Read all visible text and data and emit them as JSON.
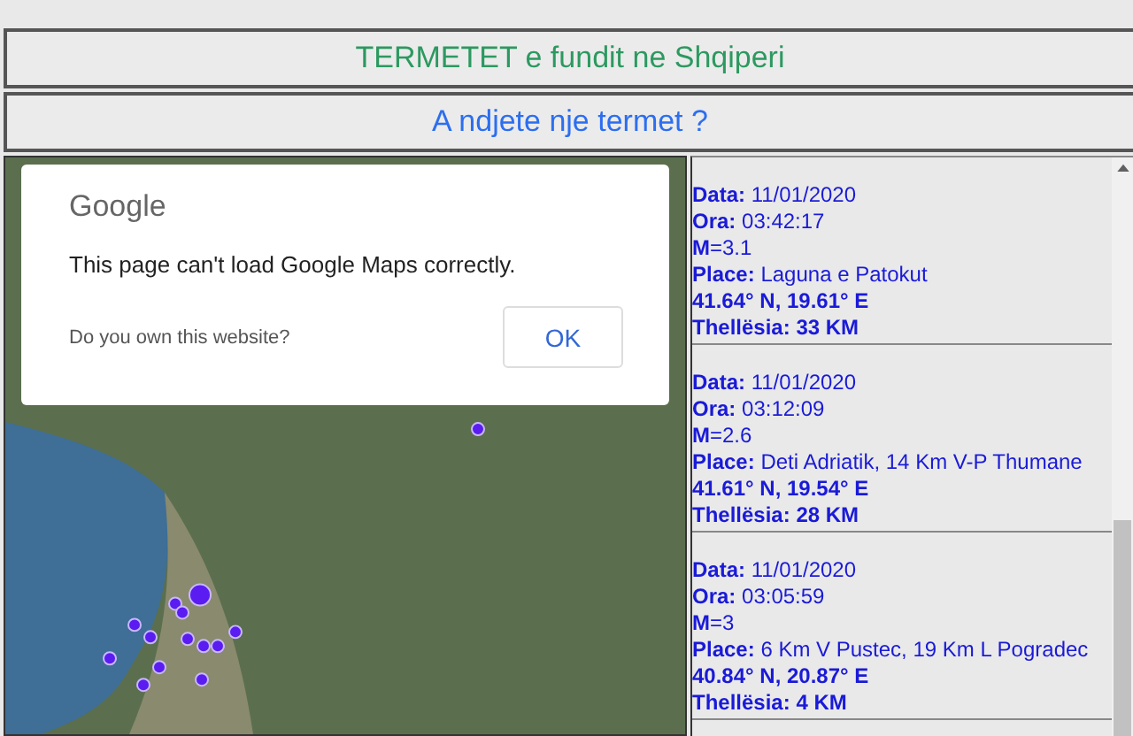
{
  "header": {
    "title": "TERMETET e fundit ne Shqiperi",
    "subtitle": "A ndjete nje termet ?"
  },
  "map_dialog": {
    "logo": "Google",
    "message": "This page can't load Google Maps correctly.",
    "link": "Do you own this website?",
    "button": "OK"
  },
  "earthquakes": [
    {
      "date": "**Data:** 11/01/2020",
      "time": "**Ora:** 03:42:17",
      "magnitude": "**M**=3.1",
      "place": "**Place:** Laguna e Patokut",
      "coordinates": "41.64° N, 19.61° E",
      "depth": "Thellësia: 33 KM"
    },
    {
      "date": "**Data:** 11/01/2020",
      "time": "**Ora:** 03:12:09",
      "magnitude": "**M**=2.6",
      "place": "**Place:** Deti Adriatik, 14 Km V-P Thumane",
      "coordinates": "41.61° N, 19.54° E",
      "depth": "Thellësia: 28 KM"
    },
    {
      "date": "**Data:** 11/01/2020",
      "time": "**Ora:** 03:05:59",
      "magnitude": "**M**=3",
      "place": "**Place:** 6 Km V Pustec, 19 Km L Pogradec",
      "coordinates": "40.84° N, 20.87° E",
      "depth": "Thellësia: 4 KM"
    }
  ]
}
